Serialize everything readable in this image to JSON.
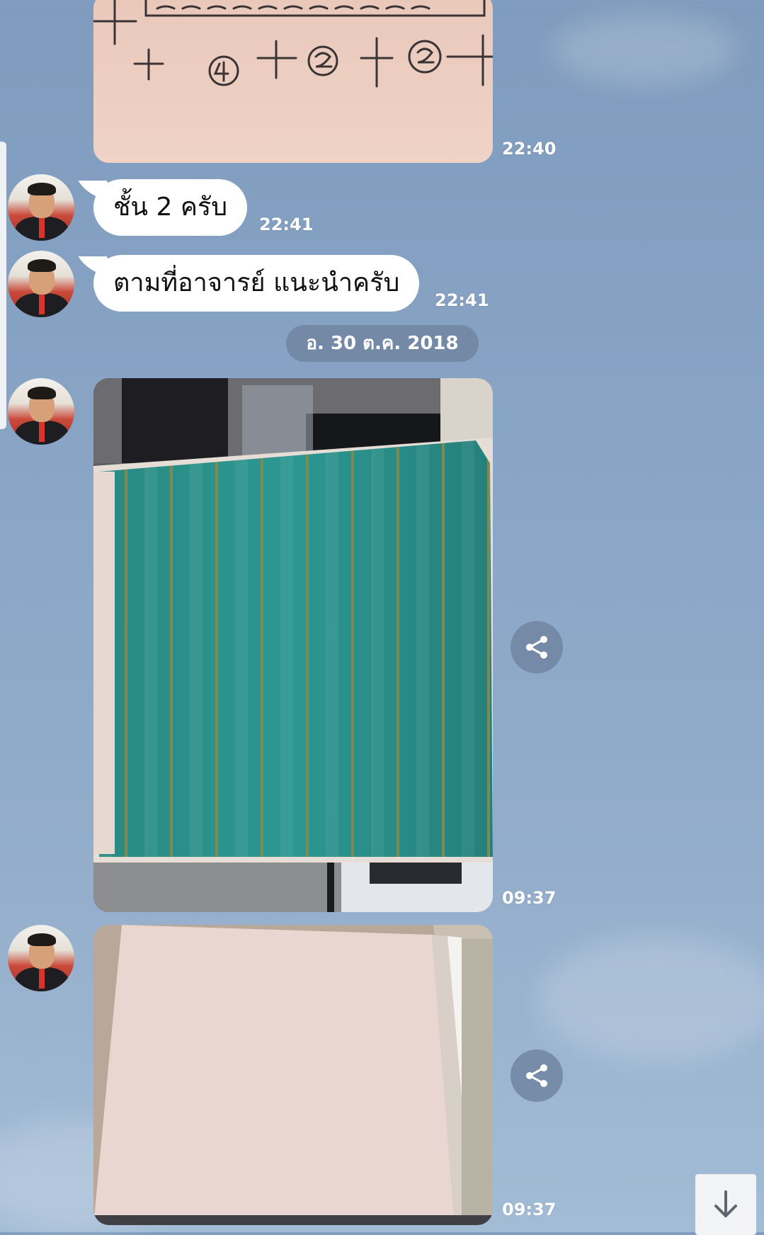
{
  "messages": [
    {
      "type": "image",
      "description": "handwritten sketch",
      "time": "22:40"
    },
    {
      "type": "text",
      "text": "ชั้น 2 ครับ",
      "time": "22:41"
    },
    {
      "type": "text",
      "text": "ตามที่อาจารย์ แนะนำครับ",
      "time": "22:41"
    },
    {
      "type": "date",
      "text": "อ. 30 ต.ค. 2018"
    },
    {
      "type": "image",
      "description": "green striped wallpaper sample",
      "time": "09:37"
    },
    {
      "type": "image",
      "description": "light pink wallpaper sample",
      "time": "09:37"
    }
  ],
  "icons": {
    "share": "share-icon",
    "scroll_down": "arrow-down-icon"
  },
  "colors": {
    "background": "#8aa5c6",
    "bubble": "#ffffff",
    "date_pill": "#7085a0",
    "wallpaper_green": "#2a8d86",
    "wallpaper_pink": "#ead7d2"
  }
}
